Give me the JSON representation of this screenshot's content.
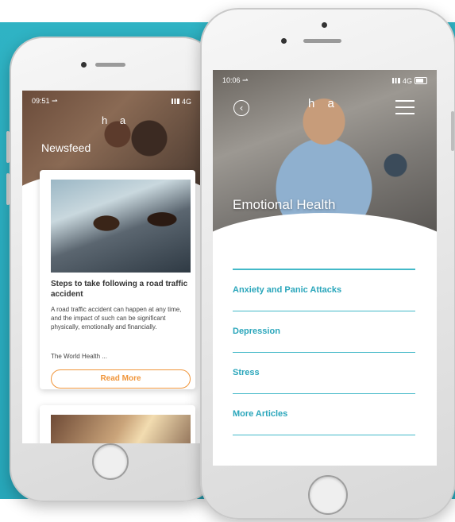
{
  "colors": {
    "background_teal": "#2fb3c4",
    "accent_teal": "#2aa6bb",
    "accent_orange": "#f0953a",
    "white": "#ffffff"
  },
  "back_phone": {
    "status": {
      "time": "09:51 ⇀",
      "carrier": "4G"
    },
    "logo": "h a",
    "header_title": "Newsfeed",
    "article": {
      "title": "Steps to take following a road traffic accident",
      "body": "A road traffic accident can happen at any time, and the impact of such can be significant physically, emotionally and financially.",
      "source": "The World Health ...",
      "button_label": "Read More"
    }
  },
  "front_phone": {
    "status": {
      "time": "10:06 ⇀",
      "carrier": "4G"
    },
    "logo": "h a",
    "back_icon": "chevron-left-icon",
    "menu_icon": "hamburger-menu-icon",
    "hero_title": "Emotional Health",
    "topics": [
      {
        "label": "Anxiety and Panic Attacks"
      },
      {
        "label": "Depression"
      },
      {
        "label": "Stress"
      },
      {
        "label": "More Articles"
      }
    ]
  }
}
